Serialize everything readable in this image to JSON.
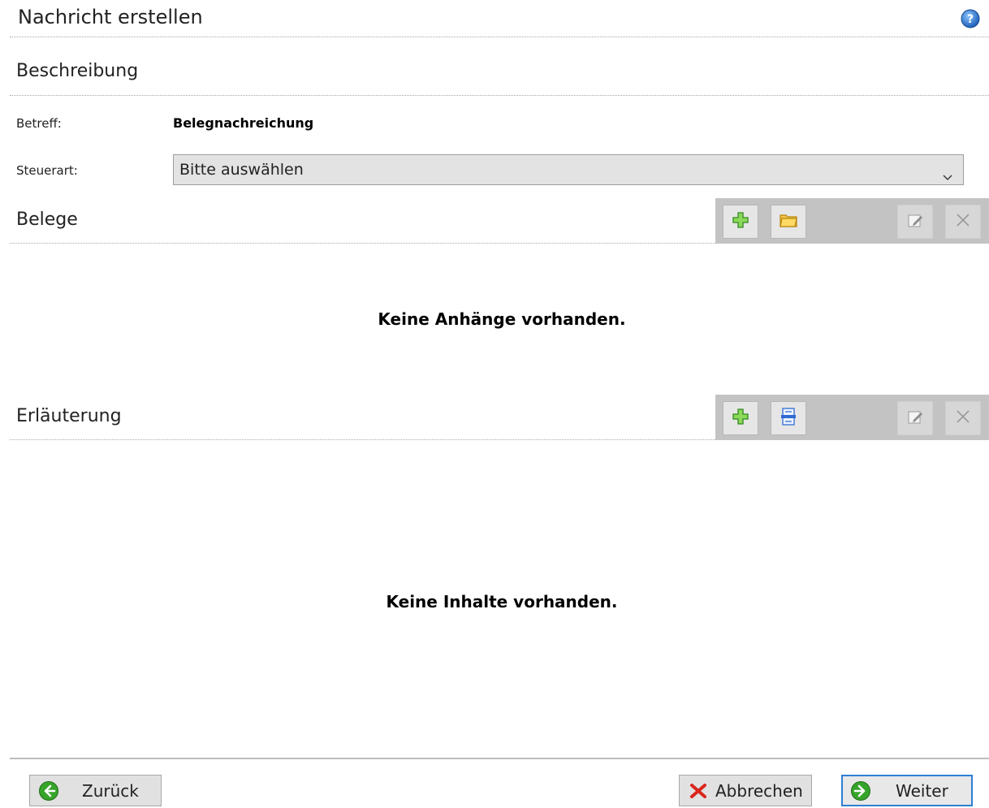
{
  "header": {
    "title": "Nachricht erstellen",
    "help_icon": "help-icon"
  },
  "beschreibung": {
    "section_title": "Beschreibung",
    "betreff_label": "Betreff:",
    "betreff_value": "Belegnachreichung",
    "steuerart_label": "Steuerart:",
    "steuerart_value": "Bitte auswählen"
  },
  "belege": {
    "section_title": "Belege",
    "toolbar": [
      "add-icon",
      "folder-icon",
      "edit-icon",
      "delete-icon"
    ],
    "empty_message": "Keine Anhänge vorhanden."
  },
  "erlaeuterung": {
    "section_title": "Erläuterung",
    "toolbar": [
      "add-icon",
      "scan-document-icon",
      "edit-icon",
      "delete-icon"
    ],
    "empty_message": "Keine Inhalte vorhanden."
  },
  "footer": {
    "back_label": "Zurück",
    "cancel_label": "Abbrechen",
    "next_label": "Weiter"
  },
  "colors": {
    "accent": "#2f7fd4",
    "toolbar_bg": "#c3c3c3",
    "green_icon": "#3ea62b",
    "red_icon": "#d9261c"
  }
}
